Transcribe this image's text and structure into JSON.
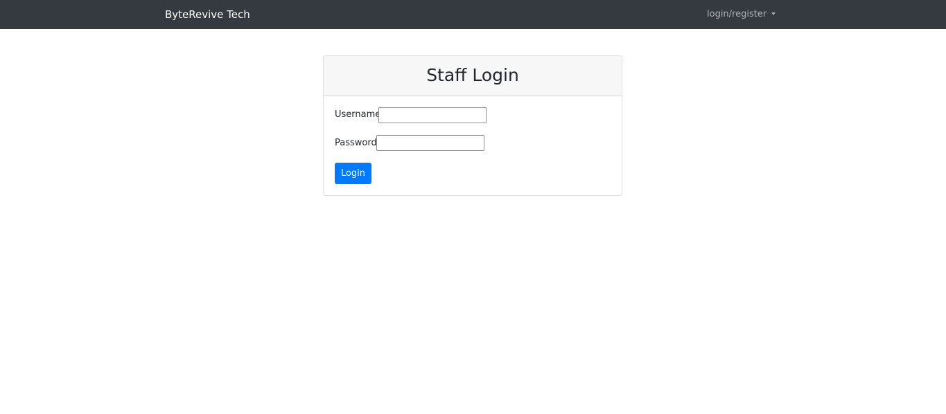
{
  "navbar": {
    "brand": "ByteRevive Tech",
    "dropdown_label": "login/register",
    "background_color": "#343a40"
  },
  "login_card": {
    "title": "Staff Login",
    "username_label": "Username",
    "username_value": "",
    "password_label": "Password",
    "password_value": "",
    "submit_label": "Login",
    "accent_color": "#007bff"
  }
}
